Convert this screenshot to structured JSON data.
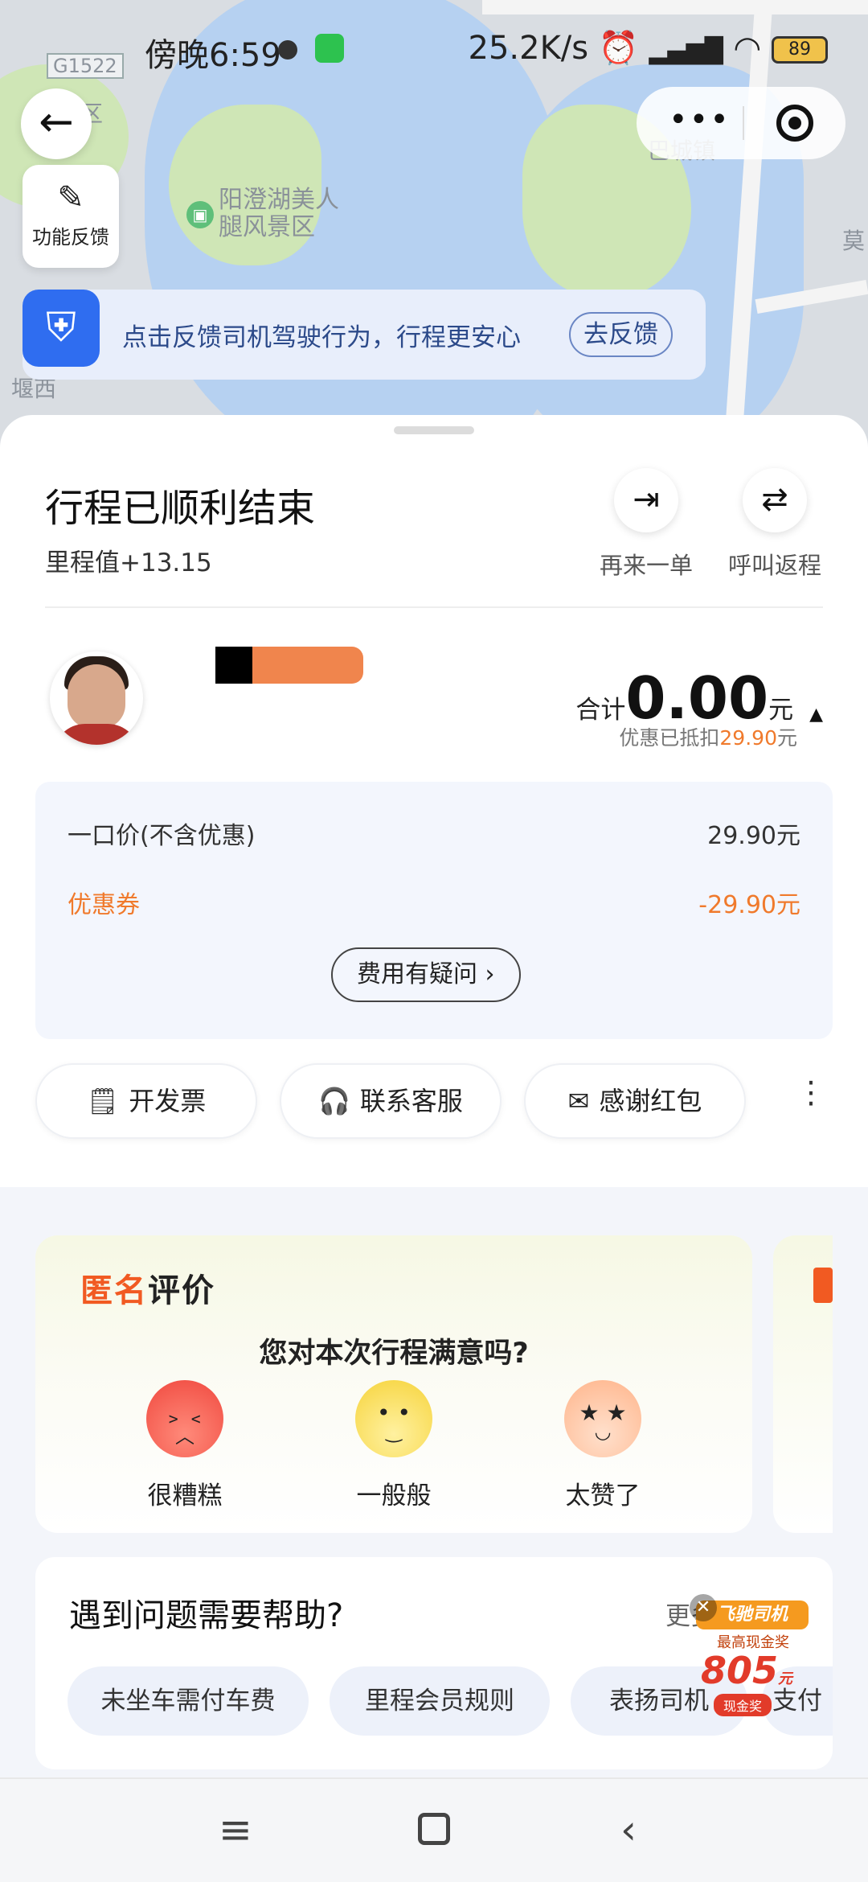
{
  "status_bar": {
    "time": "傍晚6:59",
    "network_speed": "25.2K/s",
    "signal": "HD",
    "battery": "89"
  },
  "map": {
    "labels": [
      "G1522",
      "区",
      "巴城镇",
      "阳澄湖美人",
      "腿风景区",
      "堰西",
      "莫"
    ]
  },
  "map_controls": {
    "back_glyph": "←",
    "feedback_label": "功能反馈",
    "menu_glyph": "•••"
  },
  "safety_banner": {
    "text": "点击反馈司机驾驶行为，行程更安心",
    "button": "去反馈"
  },
  "trip": {
    "title": "行程已顺利结束",
    "mileage": "里程值+13.15",
    "actions": [
      {
        "label": "再来一单",
        "icon": "arrow-exit-icon"
      },
      {
        "label": "呼叫返程",
        "icon": "swap-icon"
      }
    ]
  },
  "payment": {
    "total_label": "合计",
    "total_amount": "0.00",
    "unit": "元",
    "discount_prefix": "优惠已抵扣",
    "discount_amount": "29.90",
    "discount_unit": "元"
  },
  "fees": {
    "rows": [
      {
        "label": "一口价(不含优惠)",
        "value": "29.90元"
      },
      {
        "label": "优惠券",
        "value": "-29.90元"
      }
    ],
    "question_button": "费用有疑问 ›"
  },
  "quick_actions": [
    {
      "label": "开发票",
      "icon": "invoice-icon"
    },
    {
      "label": "联系客服",
      "icon": "headset-icon"
    },
    {
      "label": "感谢红包",
      "icon": "redpacket-icon"
    }
  ],
  "rating": {
    "title_a": "匿名",
    "title_b": "评价",
    "question": "您对本次行程满意吗?",
    "options": [
      {
        "label": "很糟糕",
        "color": "#f0483e"
      },
      {
        "label": "一般般",
        "color": "#f6d33a"
      },
      {
        "label": "太赞了",
        "color": "#ffb48a"
      }
    ]
  },
  "help": {
    "title": "遇到问题需要帮助?",
    "more": "更多 ›",
    "chips": [
      "未坐车需付车费",
      "里程会员规则",
      "表扬司机",
      "支付"
    ]
  },
  "promo": {
    "banner": "飞驰司机",
    "sub": "最高现金奖",
    "amount": "805",
    "unit": "元",
    "pill": "现金奖"
  },
  "colors": {
    "accent_blue": "#2f6df0",
    "orange": "#f07a2c",
    "brand_orange": "#f15a22"
  }
}
